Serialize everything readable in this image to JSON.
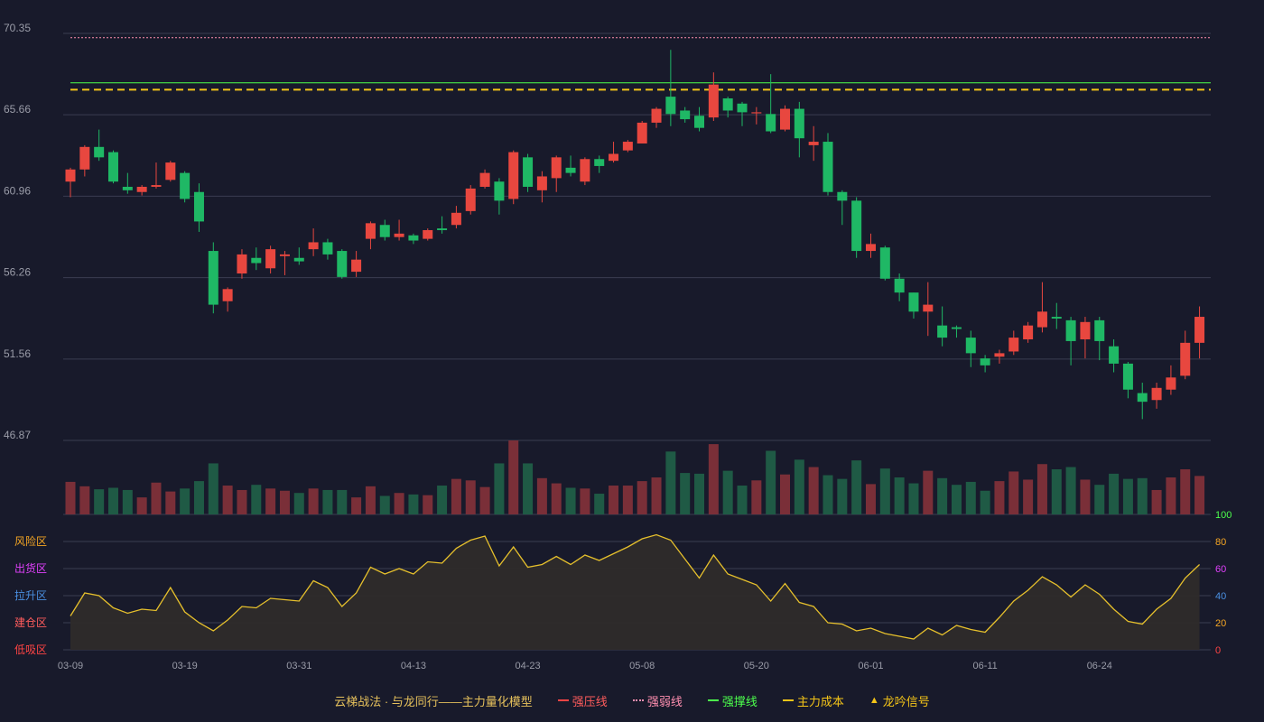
{
  "colors": {
    "background": "#181a2b",
    "up": "#e8473f",
    "down": "#1fb865",
    "grid": "#3a3d52",
    "axis_text": "#9a9ca8",
    "resistance_line": "#ff4444",
    "weak_line": "#ff8fb0",
    "support_line": "#4cff4c",
    "cost_line": "#f5c518",
    "osc_line": "#e6c02c"
  },
  "chart_data": {
    "type": "candlestick",
    "price_ticks": [
      "70.35",
      "65.66",
      "60.96",
      "56.26",
      "51.56",
      "46.87"
    ],
    "price_range": [
      46.87,
      70.35
    ],
    "date_ticks": [
      {
        "i": 0,
        "label": "03-09"
      },
      {
        "i": 8,
        "label": "03-19"
      },
      {
        "i": 16,
        "label": "03-31"
      },
      {
        "i": 24,
        "label": "04-13"
      },
      {
        "i": 32,
        "label": "04-23"
      },
      {
        "i": 40,
        "label": "05-08"
      },
      {
        "i": 48,
        "label": "05-20"
      },
      {
        "i": 56,
        "label": "06-01"
      },
      {
        "i": 64,
        "label": "06-11"
      },
      {
        "i": 72,
        "label": "06-24"
      }
    ],
    "reference_lines": {
      "weak_line": 70.1,
      "support_line": 67.5,
      "main_cost": 67.1
    },
    "candles": [
      [
        61.8,
        62.5,
        60.9,
        62.6
      ],
      [
        62.5,
        63.8,
        62.1,
        63.9
      ],
      [
        63.8,
        63.2,
        63.0,
        64.8
      ],
      [
        63.5,
        61.8,
        61.7,
        63.6
      ],
      [
        61.5,
        61.3,
        61.1,
        62.3
      ],
      [
        61.2,
        61.5,
        61.0,
        61.6
      ],
      [
        61.5,
        61.6,
        61.4,
        62.9
      ],
      [
        61.9,
        62.9,
        61.8,
        63.0
      ],
      [
        62.3,
        60.8,
        60.6,
        62.4
      ],
      [
        61.2,
        59.5,
        58.9,
        61.7
      ],
      [
        57.8,
        54.7,
        54.2,
        58.3
      ],
      [
        54.9,
        55.6,
        54.3,
        55.7
      ],
      [
        56.5,
        57.6,
        56.2,
        57.9
      ],
      [
        57.4,
        57.1,
        56.7,
        58.0
      ],
      [
        56.8,
        57.9,
        56.5,
        58.1
      ],
      [
        57.5,
        57.6,
        56.4,
        57.8
      ],
      [
        57.4,
        57.2,
        57.0,
        58.0
      ],
      [
        57.9,
        58.3,
        57.5,
        59.1
      ],
      [
        58.3,
        57.6,
        57.3,
        58.5
      ],
      [
        57.8,
        56.3,
        56.2,
        57.9
      ],
      [
        56.6,
        57.3,
        56.3,
        57.8
      ],
      [
        58.5,
        59.4,
        57.9,
        59.5
      ],
      [
        59.3,
        58.6,
        58.4,
        59.6
      ],
      [
        58.6,
        58.8,
        58.4,
        59.6
      ],
      [
        58.7,
        58.4,
        58.2,
        58.8
      ],
      [
        58.5,
        59.0,
        58.4,
        59.1
      ],
      [
        59.1,
        59.0,
        58.8,
        59.8
      ],
      [
        59.3,
        60.0,
        59.1,
        60.4
      ],
      [
        60.1,
        61.4,
        59.9,
        61.6
      ],
      [
        61.5,
        62.3,
        61.4,
        62.5
      ],
      [
        61.8,
        60.7,
        59.9,
        62.0
      ],
      [
        60.8,
        63.5,
        60.5,
        63.6
      ],
      [
        63.2,
        61.5,
        61.2,
        63.4
      ],
      [
        61.3,
        62.1,
        60.6,
        62.4
      ],
      [
        62.0,
        63.2,
        61.2,
        63.3
      ],
      [
        62.6,
        62.3,
        62.1,
        63.3
      ],
      [
        61.8,
        63.1,
        61.6,
        63.2
      ],
      [
        63.1,
        62.7,
        62.3,
        63.3
      ],
      [
        63.0,
        63.4,
        62.9,
        64.1
      ],
      [
        63.6,
        64.1,
        63.5,
        64.2
      ],
      [
        64.0,
        65.2,
        64.0,
        65.3
      ],
      [
        65.2,
        66.0,
        64.9,
        66.1
      ],
      [
        66.7,
        65.7,
        65.0,
        69.4
      ],
      [
        65.9,
        65.4,
        65.2,
        66.1
      ],
      [
        65.6,
        64.9,
        64.7,
        66.1
      ],
      [
        65.5,
        67.4,
        65.3,
        68.1
      ],
      [
        66.6,
        65.9,
        65.5,
        66.7
      ],
      [
        66.3,
        65.8,
        65.0,
        66.4
      ],
      [
        65.8,
        65.8,
        65.1,
        66.1
      ],
      [
        65.7,
        64.7,
        64.6,
        68.0
      ],
      [
        64.8,
        66.0,
        64.7,
        66.2
      ],
      [
        66.0,
        64.3,
        63.2,
        66.4
      ],
      [
        63.9,
        64.1,
        63.0,
        65.0
      ],
      [
        64.1,
        61.2,
        61.0,
        64.6
      ],
      [
        61.2,
        60.7,
        59.3,
        61.3
      ],
      [
        60.7,
        57.8,
        57.4,
        60.9
      ],
      [
        57.8,
        58.2,
        57.4,
        58.8
      ],
      [
        58.0,
        56.2,
        56.1,
        58.1
      ],
      [
        56.2,
        55.4,
        54.9,
        56.5
      ],
      [
        55.4,
        54.3,
        53.9,
        55.4
      ],
      [
        54.3,
        54.7,
        52.9,
        56.0
      ],
      [
        53.5,
        52.8,
        52.3,
        54.6
      ],
      [
        53.4,
        53.3,
        52.8,
        53.5
      ],
      [
        52.8,
        51.9,
        51.1,
        53.2
      ],
      [
        51.6,
        51.2,
        50.8,
        51.8
      ],
      [
        51.7,
        51.9,
        51.3,
        52.1
      ],
      [
        52.0,
        52.8,
        51.8,
        53.2
      ],
      [
        52.7,
        53.5,
        52.5,
        53.7
      ],
      [
        53.4,
        54.3,
        53.1,
        56.0
      ],
      [
        54.0,
        53.9,
        53.3,
        54.8
      ],
      [
        53.8,
        52.6,
        51.2,
        54.0
      ],
      [
        52.7,
        53.7,
        51.6,
        54.0
      ],
      [
        53.8,
        52.6,
        51.5,
        54.0
      ],
      [
        52.3,
        51.3,
        50.8,
        52.7
      ],
      [
        51.3,
        49.8,
        49.3,
        51.4
      ],
      [
        49.6,
        49.1,
        48.1,
        50.2
      ],
      [
        49.2,
        49.9,
        48.7,
        50.2
      ],
      [
        49.8,
        50.5,
        49.5,
        51.2
      ],
      [
        50.6,
        52.5,
        50.4,
        53.2
      ],
      [
        52.5,
        54.0,
        51.6,
        54.6
      ]
    ],
    "volume": [
      44,
      38,
      34,
      36,
      33,
      23,
      43,
      31,
      35,
      45,
      69,
      39,
      33,
      40,
      35,
      32,
      29,
      35,
      33,
      33,
      23,
      38,
      25,
      29,
      27,
      26,
      39,
      48,
      46,
      37,
      69,
      100,
      69,
      49,
      42,
      36,
      35,
      28,
      39,
      39,
      45,
      50,
      85,
      56,
      55,
      95,
      59,
      39,
      46,
      86,
      54,
      74,
      64,
      53,
      48,
      73,
      41,
      62,
      50,
      42,
      59,
      49,
      40,
      44,
      32,
      45,
      58,
      47,
      68,
      61,
      64,
      47,
      40,
      55,
      48,
      49,
      33,
      50,
      61,
      52
    ],
    "oscillator_axis": [
      "100",
      "80",
      "60",
      "40",
      "20",
      "0"
    ],
    "oscillator_labels": [
      "风险区",
      "出货区",
      "拉升区",
      "建仓区",
      "低吸区"
    ],
    "oscillator": [
      25,
      42,
      40,
      31,
      27,
      30,
      29,
      46,
      28,
      20,
      14,
      22,
      32,
      31,
      38,
      37,
      36,
      51,
      46,
      32,
      42,
      61,
      56,
      60,
      56,
      65,
      64,
      75,
      81,
      84,
      62,
      76,
      61,
      63,
      69,
      63,
      70,
      66,
      71,
      76,
      82,
      85,
      81,
      67,
      53,
      70,
      56,
      52,
      48,
      36,
      49,
      35,
      32,
      20,
      19,
      14,
      16,
      12,
      10,
      8,
      16,
      11,
      18,
      15,
      13,
      24,
      36,
      44,
      54,
      48,
      39,
      48,
      41,
      30,
      21,
      19,
      30,
      38,
      53,
      63
    ]
  },
  "legend": {
    "title": "云梯战法 · 与龙同行——主力量化模型",
    "items": [
      {
        "label": "强压线",
        "color": "#ff4444",
        "style": "solid"
      },
      {
        "label": "强弱线",
        "color": "#ff8fb0",
        "style": "dotted"
      },
      {
        "label": "强撑线",
        "color": "#4cff4c",
        "style": "solid"
      },
      {
        "label": "主力成本",
        "color": "#f5c518",
        "style": "dashed"
      },
      {
        "label": "龙吟信号",
        "color": "#f5c518",
        "style": "triangle"
      }
    ]
  }
}
